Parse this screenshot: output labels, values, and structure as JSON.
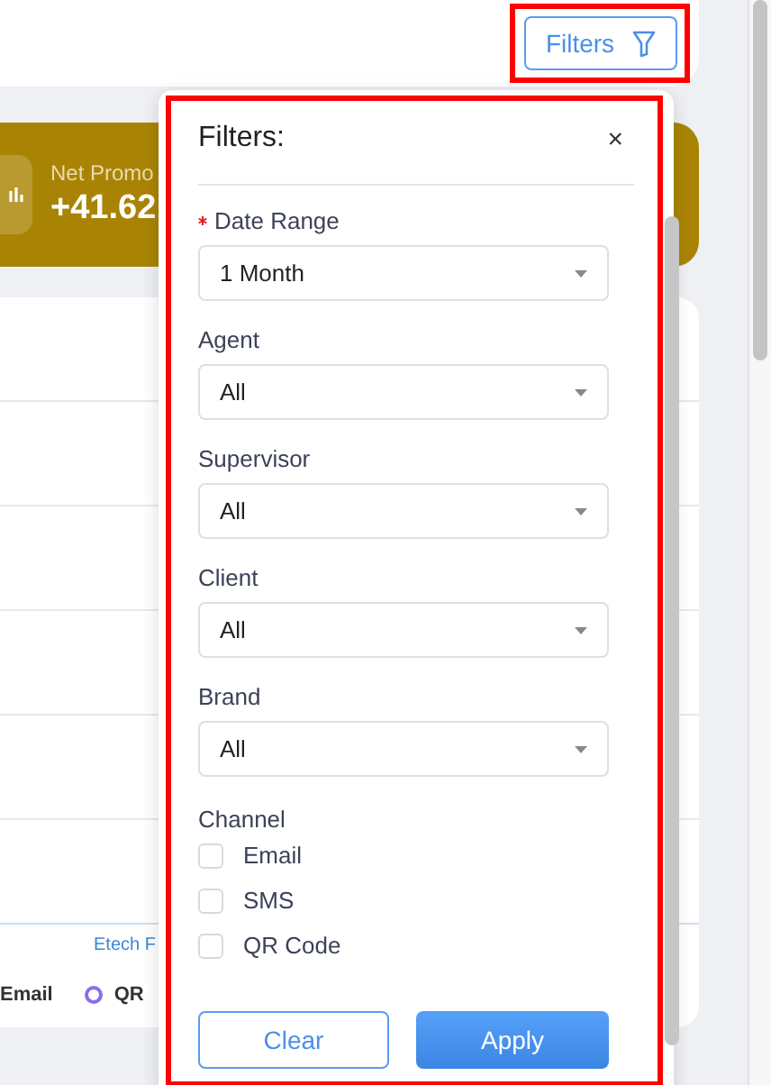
{
  "header": {
    "filters_button": "Filters"
  },
  "banner": {
    "label": "Net Promo",
    "value": "+41.62"
  },
  "card": {
    "link": "Etech F",
    "legend": [
      "Email",
      "QR"
    ]
  },
  "filters_panel": {
    "title": "Filters:",
    "close": "×",
    "fields": [
      {
        "label": "Date Range",
        "required": true,
        "value": "1 Month"
      },
      {
        "label": "Agent",
        "required": false,
        "value": "All"
      },
      {
        "label": "Supervisor",
        "required": false,
        "value": "All"
      },
      {
        "label": "Client",
        "required": false,
        "value": "All"
      },
      {
        "label": "Brand",
        "required": false,
        "value": "All"
      }
    ],
    "channel": {
      "label": "Channel",
      "options": [
        {
          "label": "Email",
          "checked": false
        },
        {
          "label": "SMS",
          "checked": false
        },
        {
          "label": "QR Code",
          "checked": false
        }
      ]
    },
    "buttons": {
      "clear": "Clear",
      "apply": "Apply"
    }
  }
}
